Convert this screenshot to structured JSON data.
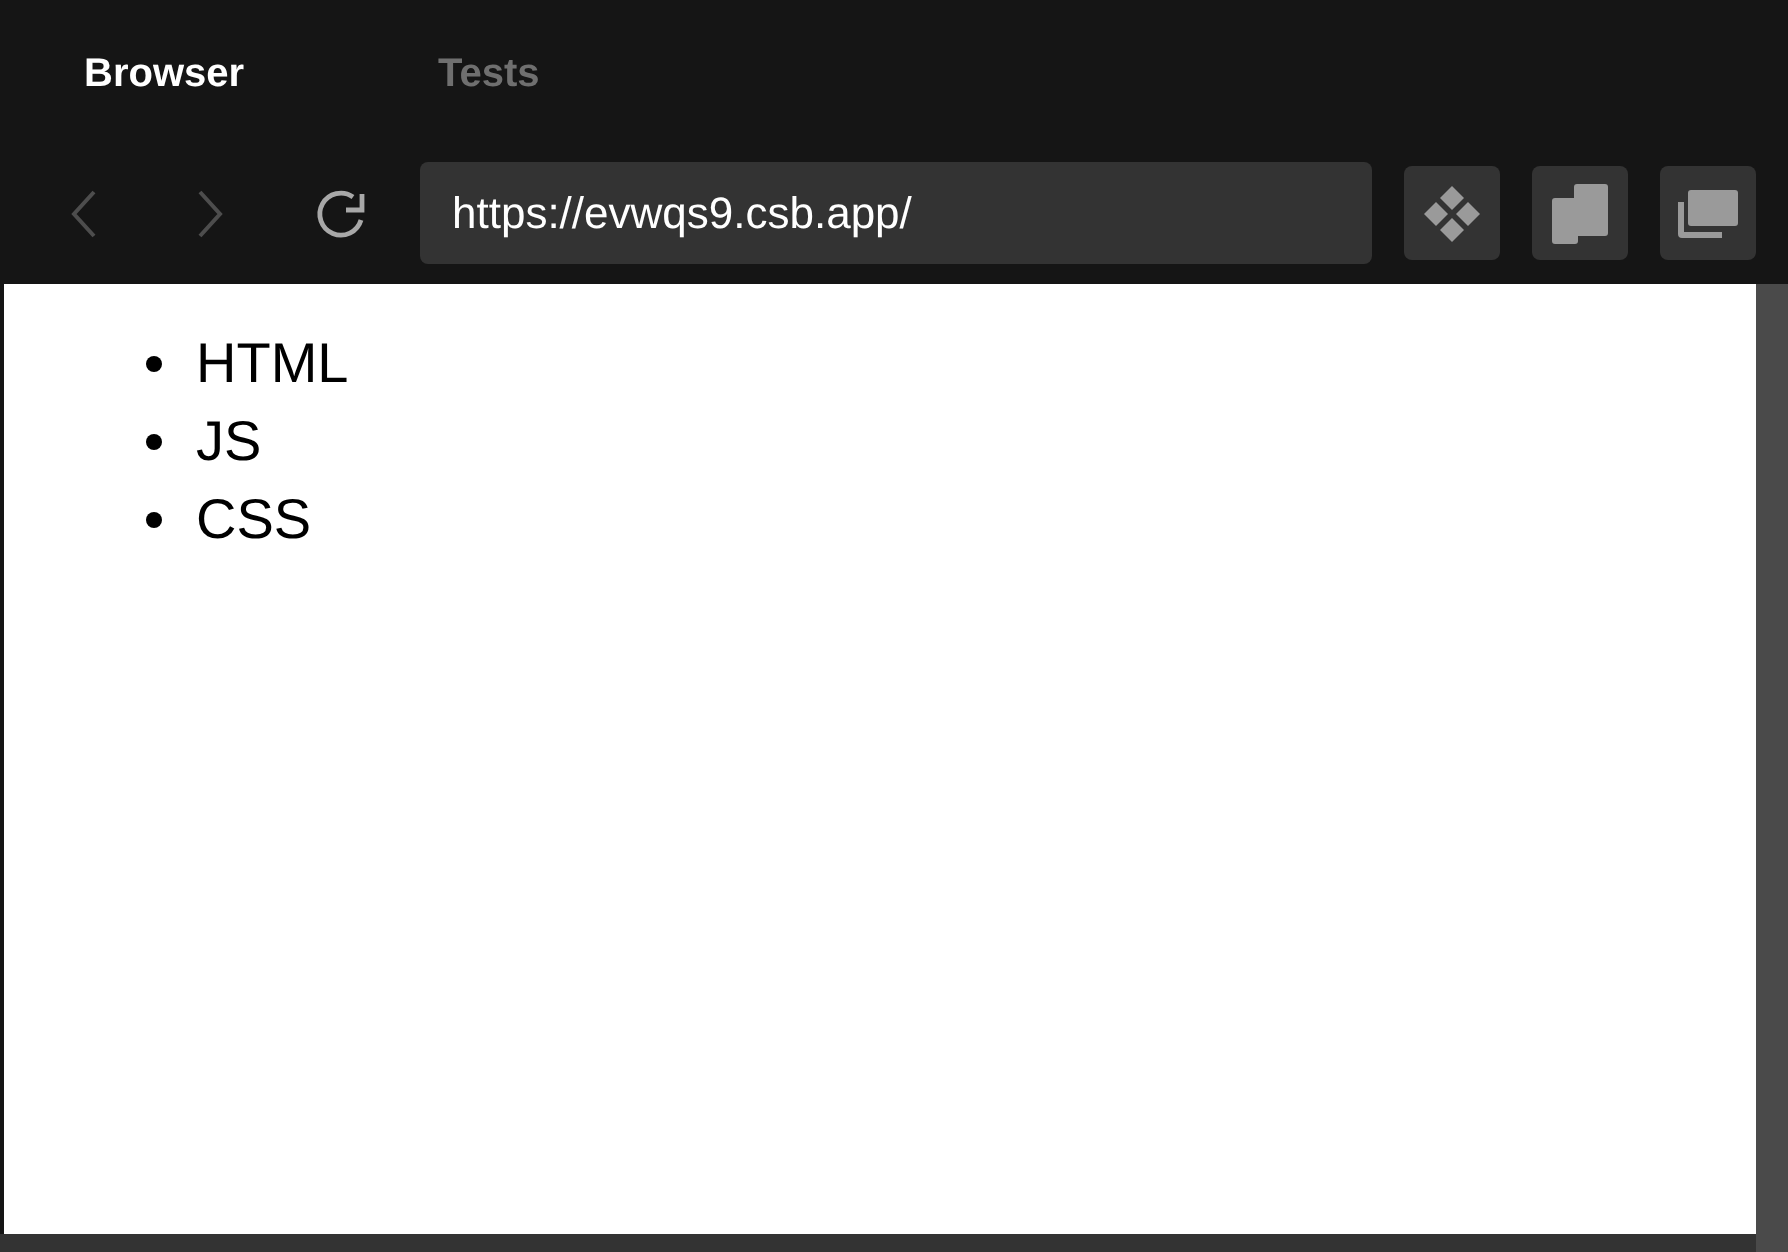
{
  "tabs": [
    {
      "label": "Browser",
      "selected": true
    },
    {
      "label": "Tests",
      "selected": false
    }
  ],
  "toolbar": {
    "nav_buttons": [
      {
        "kind": "back",
        "disabled": true
      },
      {
        "kind": "forward",
        "disabled": true
      },
      {
        "kind": "refresh",
        "disabled": false
      }
    ],
    "address": {
      "value": "https://evwqs9.csb.app/"
    },
    "action_buttons": [
      {
        "kind": "diamonds"
      },
      {
        "kind": "split"
      },
      {
        "kind": "windows"
      }
    ]
  },
  "page": {
    "list_items": [
      "HTML",
      "JS",
      "CSS"
    ]
  }
}
